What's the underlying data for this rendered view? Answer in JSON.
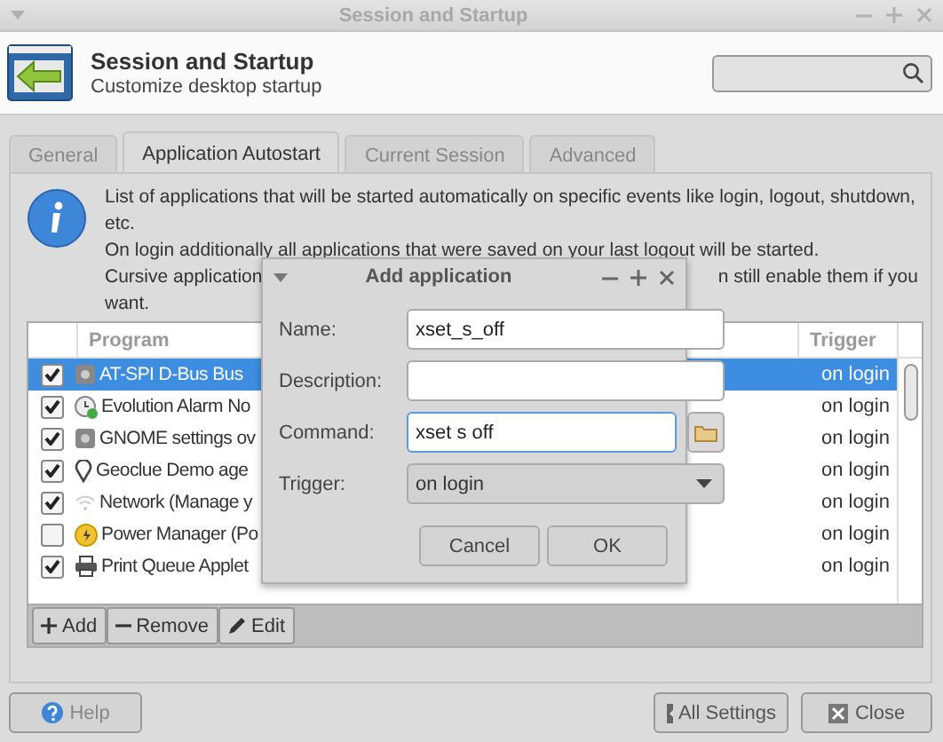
{
  "window": {
    "title": "Session and Startup"
  },
  "header": {
    "title": "Session and Startup",
    "subtitle": "Customize desktop startup"
  },
  "tabs": [
    {
      "label": "General",
      "selected": false
    },
    {
      "label": "Application Autostart",
      "selected": true
    },
    {
      "label": "Current Session",
      "selected": false
    },
    {
      "label": "Advanced",
      "selected": false
    }
  ],
  "info": {
    "lines": [
      "List of applications that will be started automatically on specific events like login, logout, shutdown,",
      "etc.",
      "On login additionally all applications that were saved on your last logout will be started."
    ],
    "partial_left": "Cursive application",
    "partial_right": "n still enable them if you",
    "last_line": "want."
  },
  "table": {
    "columns": [
      "Program",
      "Trigger"
    ],
    "rows": [
      {
        "checked": true,
        "selected": true,
        "program": "AT-SPI D-Bus Bus",
        "trigger": "on login"
      },
      {
        "checked": true,
        "selected": false,
        "program": "Evolution Alarm No",
        "trigger": "on login"
      },
      {
        "checked": true,
        "selected": false,
        "program": "GNOME settings ov",
        "trigger": "on login"
      },
      {
        "checked": true,
        "selected": false,
        "program": "Geoclue Demo age",
        "trigger": "on login"
      },
      {
        "checked": true,
        "selected": false,
        "program": "Network (Manage y",
        "trigger": "on login"
      },
      {
        "checked": false,
        "selected": false,
        "program": "Power Manager (Po",
        "trigger": "on login"
      },
      {
        "checked": true,
        "selected": false,
        "program": "Print Queue Applet",
        "trigger": "on login"
      }
    ]
  },
  "toolbar": [
    {
      "kind": "add",
      "label": "Add"
    },
    {
      "kind": "remove",
      "label": "Remove"
    },
    {
      "kind": "edit",
      "label": "Edit"
    }
  ],
  "dialog": {
    "title": "Add application",
    "fields": [
      {
        "kind": "text",
        "label": "Name:",
        "value": "xset_s_off",
        "focused": false
      },
      {
        "kind": "text",
        "label": "Description:",
        "focused": false
      },
      {
        "kind": "browse",
        "label": "Command:",
        "value": "xset s off",
        "focused": true
      },
      {
        "kind": "dropdown",
        "label": "Trigger:",
        "value": "on login",
        "focused": false
      }
    ],
    "buttons": [
      "Cancel",
      "OK"
    ]
  },
  "footer": {
    "help": "Help",
    "all_settings": "All Settings",
    "close": "Close"
  }
}
